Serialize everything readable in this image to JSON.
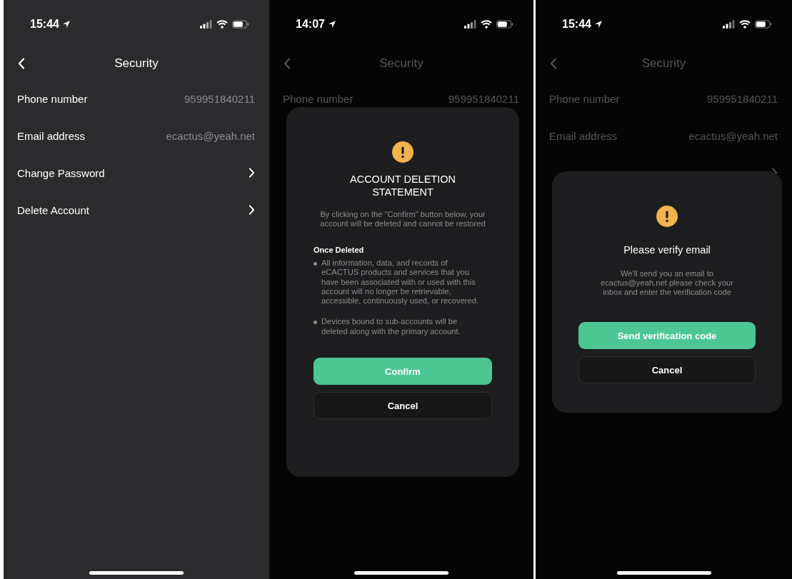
{
  "screens": [
    {
      "kind": "plain",
      "status_bar": {
        "time": "15:44"
      },
      "header": {
        "title": "Security"
      },
      "rows": [
        {
          "kind": "value",
          "label": "Phone number",
          "value": "959951840211"
        },
        {
          "kind": "value",
          "label": "Email address",
          "value": "ecactus@yeah.net"
        },
        {
          "kind": "link",
          "label": "Change Password"
        },
        {
          "kind": "link",
          "label": "Delete Account"
        }
      ]
    },
    {
      "kind": "dialog",
      "status_bar": {
        "time": "14:07"
      },
      "header": {
        "title": "Security"
      },
      "rows": [
        {
          "kind": "value",
          "label": "Phone number",
          "value": "959951840211"
        },
        {
          "kind": "covered"
        },
        {
          "kind": "covered-link"
        },
        {
          "kind": "covered-link"
        }
      ],
      "dialog": {
        "title": "ACCOUNT DELETION STATEMENT",
        "message": "By clicking on the \"Confirm\" button below, your account will be deleted and cannot be restored",
        "section_title": "Once Deleted",
        "bullets": [
          "All information, data, and records of eCACTUS products and services that you have been associated with or used with this account will no longer be retrievable, accessible, continuously used, or recovered.",
          "Devices bound to sub-accounts will be deleted along with the primary account."
        ],
        "buttons": [
          {
            "kind": "primary",
            "label": "Confirm"
          },
          {
            "kind": "secondary",
            "label": "Cancel"
          }
        ]
      }
    },
    {
      "kind": "dialog",
      "status_bar": {
        "time": "15:44"
      },
      "header": {
        "title": "Security"
      },
      "rows": [
        {
          "kind": "value",
          "label": "Phone number",
          "value": "959951840211"
        },
        {
          "kind": "value",
          "label": "Email address",
          "value": "ecactus@yeah.net"
        },
        {
          "kind": "covered-link"
        },
        {
          "kind": "covered-link"
        }
      ],
      "dialog": {
        "title": "Please verify email",
        "message": "We'll send you an email to ecactus@yeah.net please check your inbox and enter the verification code",
        "buttons": [
          {
            "kind": "primary",
            "label": "Send verification code"
          },
          {
            "kind": "secondary",
            "label": "Cancel"
          }
        ]
      }
    }
  ]
}
